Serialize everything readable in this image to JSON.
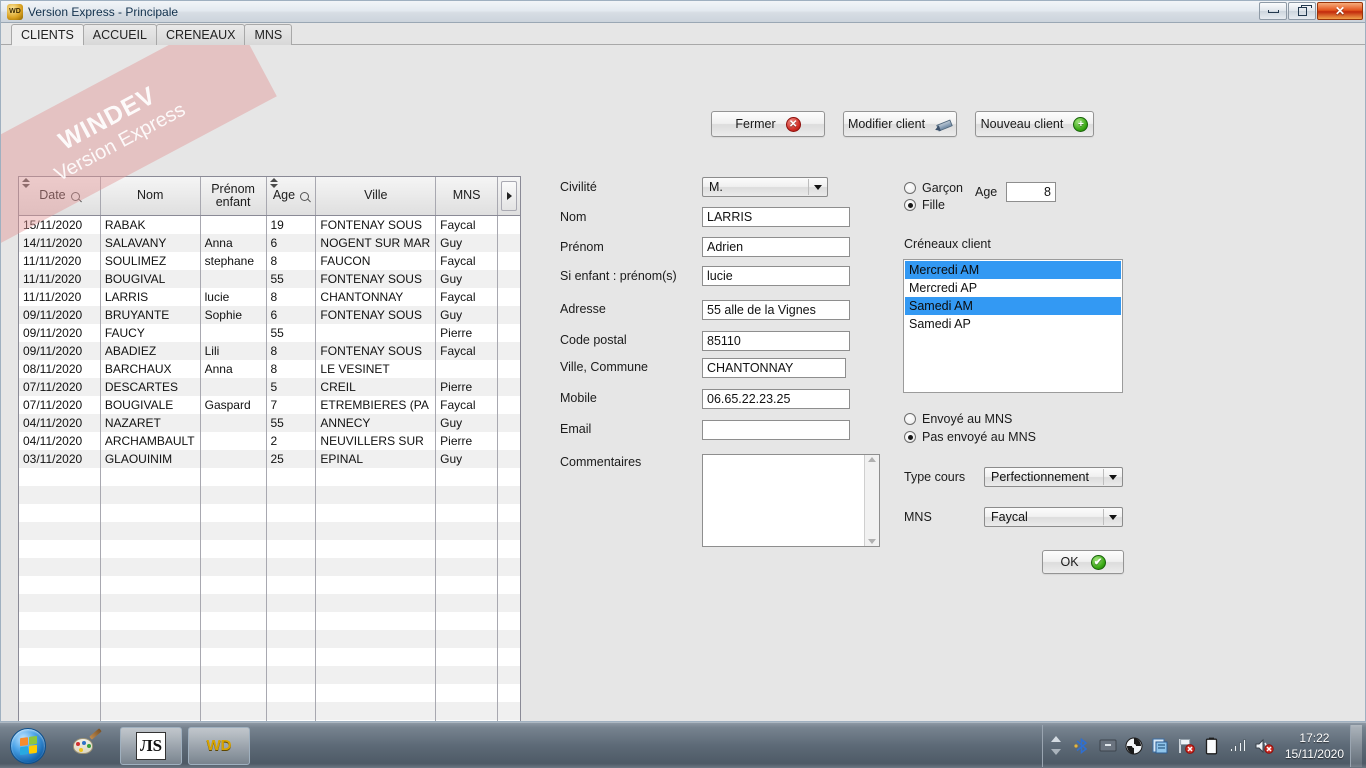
{
  "window": {
    "title": "Version Express - Principale",
    "app_icon": "windev-icon",
    "controls": {
      "minimize": "minimize-button",
      "restore": "restore-button",
      "close": "close-button"
    }
  },
  "watermark": {
    "line1": "WINDEV",
    "line2": "Version Express"
  },
  "tabs": [
    {
      "label": "CLIENTS",
      "active": true
    },
    {
      "label": "ACCUEIL",
      "active": false
    },
    {
      "label": "CRENEAUX",
      "active": false
    },
    {
      "label": "MNS",
      "active": false
    }
  ],
  "toolbar": {
    "close_label": "Fermer",
    "edit_label": "Modifier client",
    "new_label": "Nouveau client"
  },
  "grid": {
    "columns": [
      {
        "key": "date",
        "label": "Date",
        "sortable": true,
        "searchable": true
      },
      {
        "key": "nom",
        "label": "Nom",
        "sortable": false,
        "searchable": false
      },
      {
        "key": "prenom",
        "label": "Prénom enfant",
        "sortable": false,
        "searchable": false
      },
      {
        "key": "age",
        "label": "Age",
        "sortable": true,
        "searchable": true
      },
      {
        "key": "ville",
        "label": "Ville",
        "sortable": false,
        "searchable": false
      },
      {
        "key": "mns",
        "label": "MNS",
        "sortable": false,
        "searchable": false
      }
    ],
    "rows": [
      {
        "date": "15/11/2020",
        "nom": "RABAK",
        "prenom": "",
        "age": "19",
        "ville": "FONTENAY SOUS",
        "mns": "Faycal"
      },
      {
        "date": "14/11/2020",
        "nom": "SALAVANY",
        "prenom": "Anna",
        "age": "6",
        "ville": "NOGENT SUR MAR",
        "mns": "Guy"
      },
      {
        "date": "11/11/2020",
        "nom": "SOULIMEZ",
        "prenom": "stephane",
        "age": "8",
        "ville": "FAUCON",
        "mns": "Faycal"
      },
      {
        "date": "11/11/2020",
        "nom": "BOUGIVAL",
        "prenom": "",
        "age": "55",
        "ville": "FONTENAY SOUS",
        "mns": "Guy"
      },
      {
        "date": "11/11/2020",
        "nom": "LARRIS",
        "prenom": "lucie",
        "age": "8",
        "ville": "CHANTONNAY",
        "mns": "Faycal"
      },
      {
        "date": "09/11/2020",
        "nom": "BRUYANTE",
        "prenom": "Sophie",
        "age": "6",
        "ville": "FONTENAY SOUS",
        "mns": "Guy"
      },
      {
        "date": "09/11/2020",
        "nom": "FAUCY",
        "prenom": "",
        "age": "55",
        "ville": "",
        "mns": "Pierre"
      },
      {
        "date": "09/11/2020",
        "nom": "ABADIEZ",
        "prenom": "Lili",
        "age": "8",
        "ville": "FONTENAY SOUS",
        "mns": "Faycal"
      },
      {
        "date": "08/11/2020",
        "nom": "BARCHAUX",
        "prenom": "Anna",
        "age": "8",
        "ville": "LE VESINET",
        "mns": ""
      },
      {
        "date": "07/11/2020",
        "nom": "DESCARTES",
        "prenom": "",
        "age": "5",
        "ville": "CREIL",
        "mns": "Pierre"
      },
      {
        "date": "07/11/2020",
        "nom": "BOUGIVALE",
        "prenom": "Gaspard",
        "age": "7",
        "ville": "ETREMBIERES (PA",
        "mns": "Faycal"
      },
      {
        "date": "04/11/2020",
        "nom": "NAZARET",
        "prenom": "",
        "age": "55",
        "ville": "ANNECY",
        "mns": "Guy"
      },
      {
        "date": "04/11/2020",
        "nom": "ARCHAMBAULT",
        "prenom": "",
        "age": "2",
        "ville": "NEUVILLERS SUR",
        "mns": "Pierre"
      },
      {
        "date": "03/11/2020",
        "nom": "GLAOUINIM",
        "prenom": "",
        "age": "25",
        "ville": "EPINAL",
        "mns": "Guy"
      }
    ],
    "empty_rows": 17
  },
  "form": {
    "civilite_label": "Civilité",
    "civilite_value": "M.",
    "nom_label": "Nom",
    "nom_value": "LARRIS",
    "prenom_label": "Prénom",
    "prenom_value": "Adrien",
    "enfant_label": "Si enfant : prénom(s)",
    "enfant_value": "lucie",
    "adresse_label": "Adresse",
    "adresse_value": "55 alle de la Vignes",
    "cp_label": "Code postal",
    "cp_value": "85110",
    "ville_label": "Ville, Commune",
    "ville_value": "CHANTONNAY",
    "mobile_label": "Mobile",
    "mobile_value": "06.65.22.23.25",
    "email_label": "Email",
    "email_value": "",
    "commentaires_label": "Commentaires",
    "commentaires_value": ""
  },
  "panel": {
    "gender": {
      "garcon_label": "Garçon",
      "garcon_checked": false,
      "fille_label": "Fille",
      "fille_checked": true
    },
    "age_label": "Age",
    "age_value": "8",
    "creneaux_label": "Créneaux client",
    "creneaux_items": [
      {
        "label": "Mercredi AM",
        "selected": true
      },
      {
        "label": "Mercredi AP",
        "selected": false
      },
      {
        "label": "Samedi AM",
        "selected": true
      },
      {
        "label": "Samedi AP",
        "selected": false
      }
    ],
    "mns_status": {
      "sent_label": "Envoyé au MNS",
      "sent_checked": false,
      "not_sent_label": "Pas envoyé au MNS",
      "not_sent_checked": true
    },
    "type_cours_label": "Type cours",
    "type_cours_value": "Perfectionnement",
    "mns_label": "MNS",
    "mns_value": "Faycal",
    "ok_label": "OK"
  },
  "taskbar": {
    "start": "start-orb",
    "items": [
      {
        "name": "paint-taskbar-item"
      },
      {
        "name": "as-app-taskbar-item",
        "glyph": "AS"
      },
      {
        "name": "windev-taskbar-item",
        "glyph": "WD"
      }
    ],
    "clock_time": "17:22",
    "clock_date": "15/11/2020"
  },
  "colors": {
    "selection_blue": "#3399f3",
    "window_bg": "#e6e6e6",
    "grid_alt_row": "#f0f0f0",
    "watermark_red": "#e29696"
  }
}
